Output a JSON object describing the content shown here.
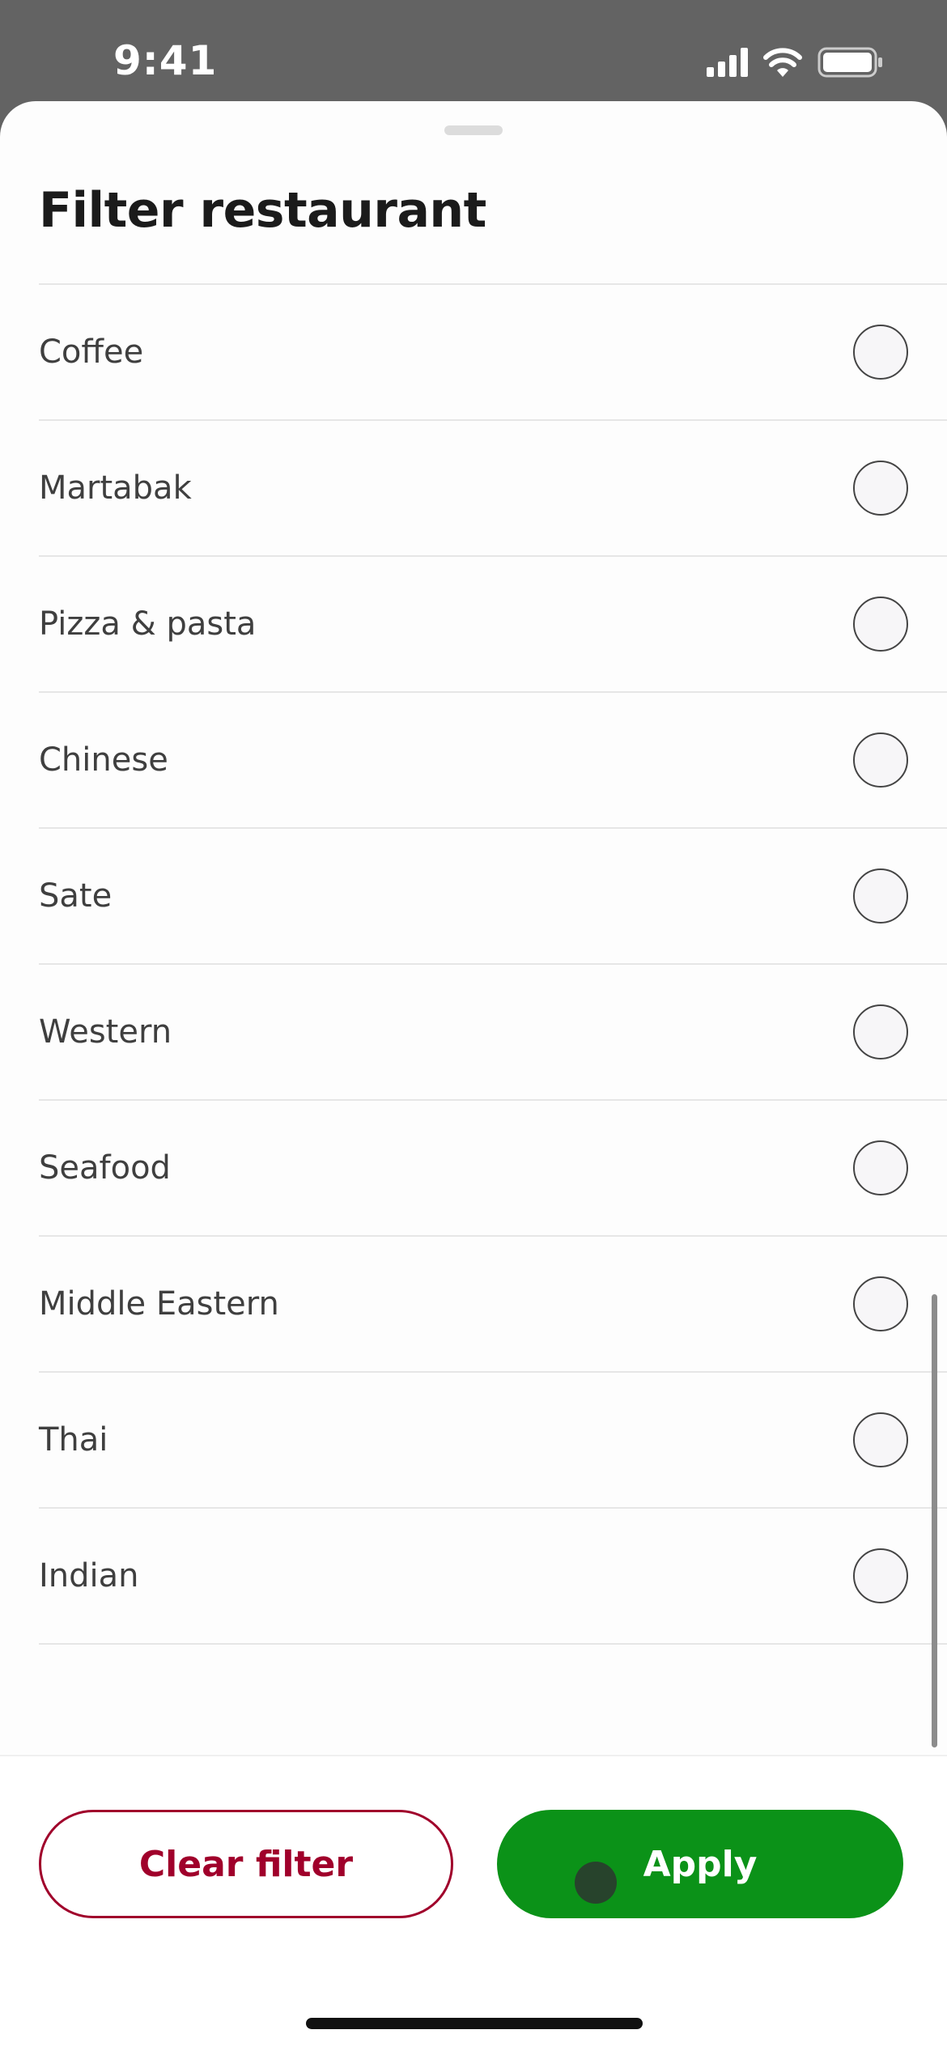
{
  "status": {
    "time": "9:41"
  },
  "sheet": {
    "title": "Filter restaurant"
  },
  "options": [
    {
      "label": "Coffee",
      "selected": false
    },
    {
      "label": "Martabak",
      "selected": false
    },
    {
      "label": "Pizza & pasta",
      "selected": false
    },
    {
      "label": "Chinese",
      "selected": false
    },
    {
      "label": "Sate",
      "selected": false
    },
    {
      "label": "Western",
      "selected": false
    },
    {
      "label": "Seafood",
      "selected": false
    },
    {
      "label": "Middle Eastern",
      "selected": false
    },
    {
      "label": "Thai",
      "selected": false
    },
    {
      "label": "Indian",
      "selected": false
    }
  ],
  "actions": {
    "clear_label": "Clear filter",
    "apply_label": "Apply"
  },
  "colors": {
    "accent_red": "#a0002b",
    "apply_green": "#0b9218"
  }
}
